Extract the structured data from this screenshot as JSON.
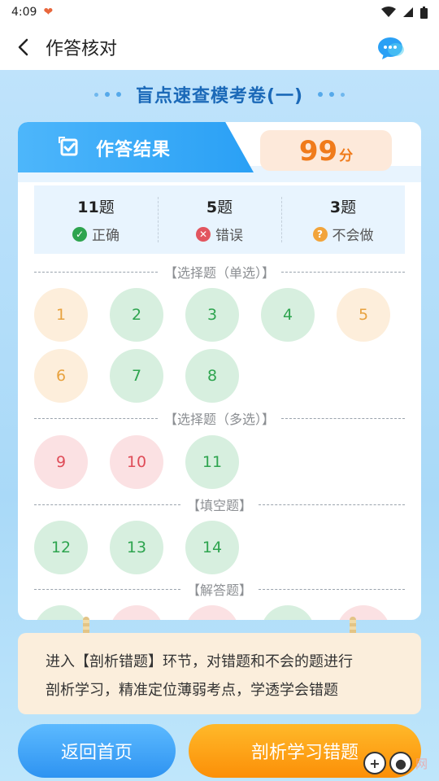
{
  "status_bar": {
    "time": "4:09"
  },
  "header": {
    "title": "作答核对"
  },
  "paper": {
    "title": "盲点速查模考卷(一)"
  },
  "result": {
    "label": "作答结果",
    "score": "99",
    "score_unit": "分"
  },
  "stats": [
    {
      "count": "11",
      "unit": "题",
      "label": "正确",
      "icon": "check-circle-icon",
      "color": "#2ea44f"
    },
    {
      "count": "5",
      "unit": "题",
      "label": "错误",
      "icon": "x-circle-icon",
      "color": "#e2555f"
    },
    {
      "count": "3",
      "unit": "题",
      "label": "不会做",
      "icon": "question-circle-icon",
      "color": "#f2a43b"
    }
  ],
  "sections": [
    {
      "title": "【选择题（单选）】"
    },
    {
      "title": "【选择题（多选）】"
    },
    {
      "title": "【填空题】"
    },
    {
      "title": "【解答题】"
    }
  ],
  "questions": [
    {
      "num": "1",
      "status": "unknown"
    },
    {
      "num": "2",
      "status": "correct"
    },
    {
      "num": "3",
      "status": "correct"
    },
    {
      "num": "4",
      "status": "correct"
    },
    {
      "num": "5",
      "status": "unknown"
    },
    {
      "num": "6",
      "status": "unknown"
    },
    {
      "num": "7",
      "status": "correct"
    },
    {
      "num": "8",
      "status": "correct"
    },
    {
      "num": "9",
      "status": "wrong"
    },
    {
      "num": "10",
      "status": "wrong"
    },
    {
      "num": "11",
      "status": "correct"
    },
    {
      "num": "12",
      "status": "correct"
    },
    {
      "num": "13",
      "status": "correct"
    },
    {
      "num": "14",
      "status": "correct"
    }
  ],
  "answer_row_partial": [
    "correct",
    "wrong",
    "wrong",
    "correct",
    "wrong"
  ],
  "hint": {
    "line1": "进入【剖析错题】环节，对错题和不会的题进行",
    "line2": "剖析学习，精准定位薄弱考点，学透学会错题"
  },
  "buttons": {
    "home": "返回首页",
    "analyze": "剖析学习错题"
  },
  "watermark": {
    "text": "网"
  },
  "colors": {
    "primary_blue": "#2aa0f5",
    "orange": "#fc8f07",
    "correct": "#2ea44f",
    "wrong": "#df4c58",
    "unknown": "#e8a23f"
  }
}
